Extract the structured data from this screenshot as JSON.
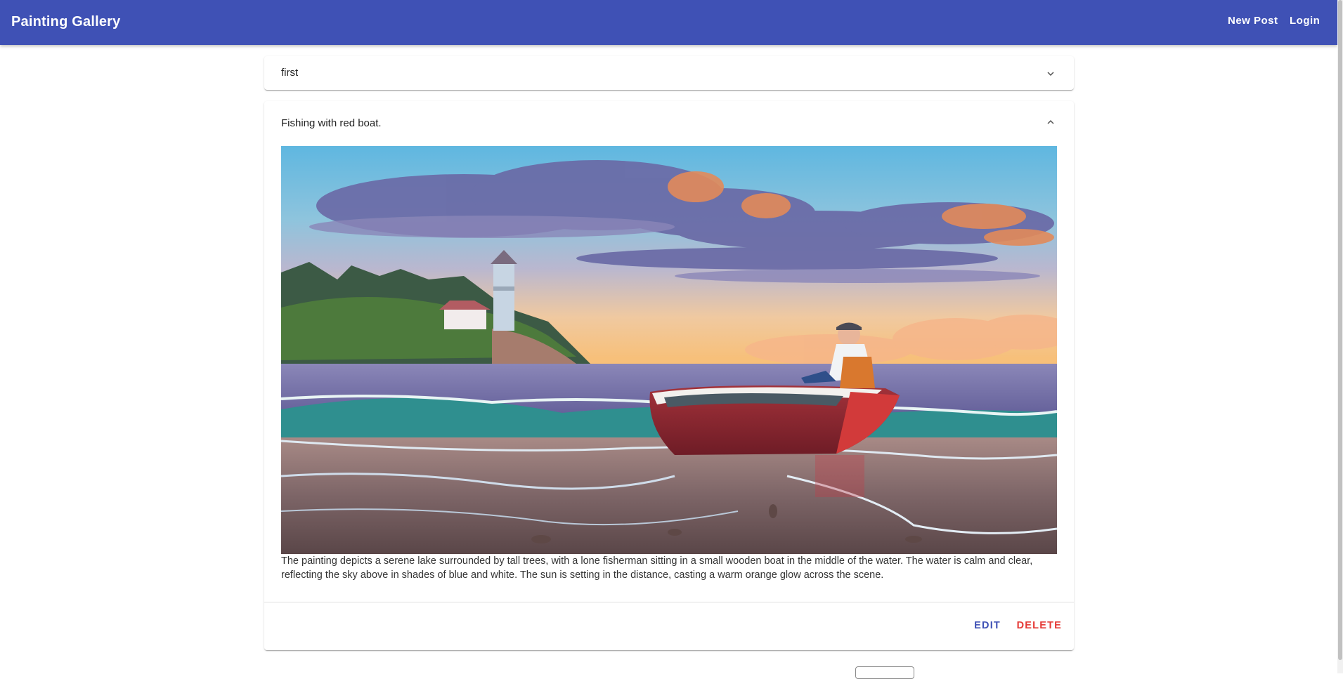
{
  "appbar": {
    "title": "Painting Gallery",
    "new_post": "New Post",
    "login": "Login",
    "color": "#3f51b5"
  },
  "posts": [
    {
      "title": "first",
      "expanded": false,
      "toggle_icon": "chevron-down-icon"
    },
    {
      "title": "Fishing with red boat.",
      "expanded": true,
      "toggle_icon": "chevron-up-icon",
      "image_subject": "sunset beach with lighthouse and fisherman in red boat",
      "description": "The painting depicts a serene lake surrounded by tall trees, with a lone fisherman sitting in a small wooden boat in the middle of the water. The water is calm and clear, reflecting the sky above in shades of blue and white. The sun is setting in the distance, casting a warm orange glow across the scene.",
      "actions": {
        "edit": "EDIT",
        "delete": "DELETE",
        "edit_color": "#3f51b5",
        "delete_color": "#e53935"
      }
    }
  ]
}
